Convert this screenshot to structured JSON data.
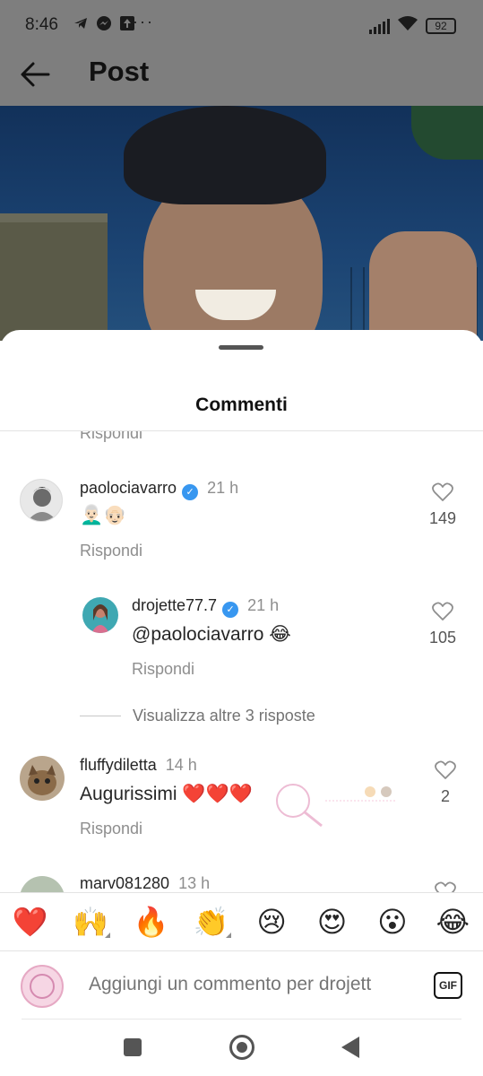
{
  "status_bar": {
    "time": "8:46",
    "dots": "···",
    "battery": "92"
  },
  "header": {
    "title": "Post"
  },
  "sheet": {
    "title": "Commenti",
    "cut_reply": "Rispondi"
  },
  "comments": [
    {
      "username": "paolociavarro",
      "verified": true,
      "time": "21 h",
      "text": "👨🏻‍🦳👴🏻",
      "reply_label": "Rispondi",
      "likes": "149"
    },
    {
      "username": "drojette77.7",
      "verified": true,
      "time": "21 h",
      "text": "@paolociavarro 😂",
      "reply_label": "Rispondi",
      "likes": "105"
    },
    {
      "username": "fluffydiletta",
      "verified": false,
      "time": "14 h",
      "text": "Augurissimi ❤️❤️❤️",
      "reply_label": "Rispondi",
      "likes": "2"
    },
    {
      "username": "marv081280",
      "verified": false,
      "time": "13 h"
    }
  ],
  "view_more": "Visualizza altre 3 risposte",
  "emoji_bar": [
    "❤️",
    "🙌",
    "🔥",
    "👏",
    "😢",
    "😍",
    "😮",
    "😂"
  ],
  "input": {
    "placeholder": "Aggiungi un commento per drojett",
    "gif_label": "GIF"
  },
  "colors": {
    "verified": "#3897f0",
    "secondary_text": "#8e8e8e",
    "dim_overlay": "#7e7e7e"
  }
}
